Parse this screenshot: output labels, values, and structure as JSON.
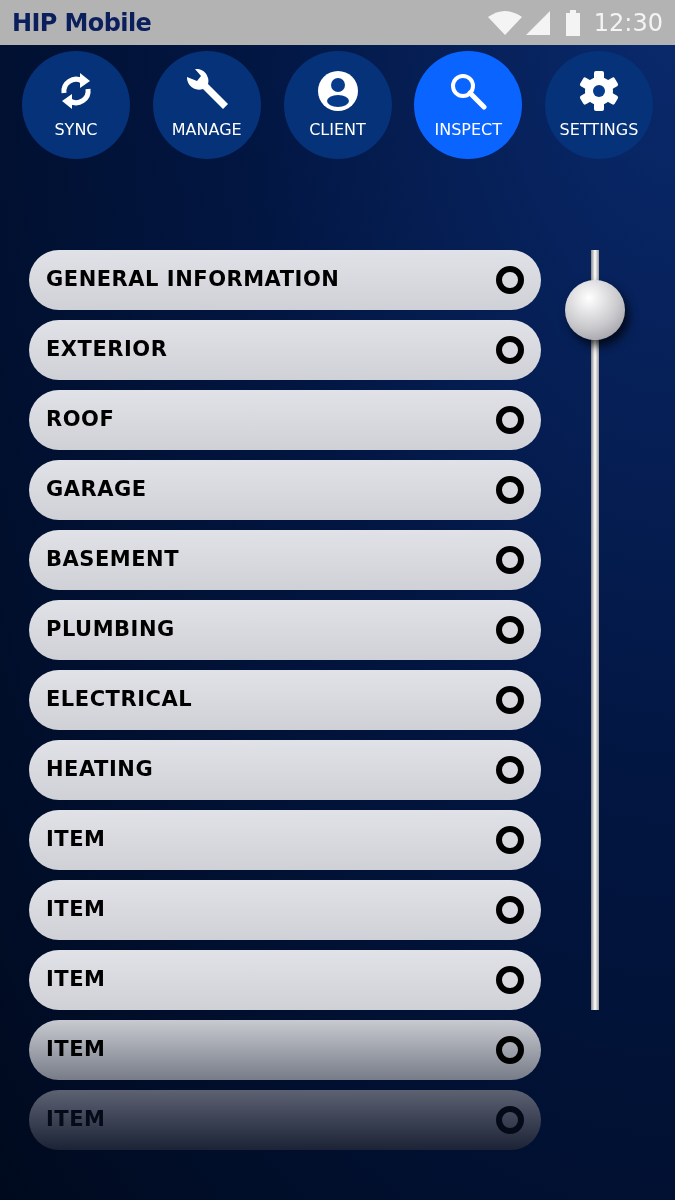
{
  "status_bar": {
    "app_title": "HIP Mobile",
    "time": "12:30"
  },
  "nav": [
    {
      "label": "SYNC",
      "selected": false
    },
    {
      "label": "MANAGE",
      "selected": false
    },
    {
      "label": "CLIENT",
      "selected": false
    },
    {
      "label": "INSPECT",
      "selected": true
    },
    {
      "label": "SETTINGS",
      "selected": false
    }
  ],
  "sections": [
    {
      "label": "GENERAL INFORMATION"
    },
    {
      "label": "EXTERIOR"
    },
    {
      "label": "ROOF"
    },
    {
      "label": "GARAGE"
    },
    {
      "label": "BASEMENT"
    },
    {
      "label": "PLUMBING"
    },
    {
      "label": "ELECTRICAL"
    },
    {
      "label": "HEATING"
    },
    {
      "label": "ITEM"
    },
    {
      "label": "ITEM"
    },
    {
      "label": "ITEM"
    },
    {
      "label": "ITEM"
    },
    {
      "label": "ITEM"
    }
  ]
}
